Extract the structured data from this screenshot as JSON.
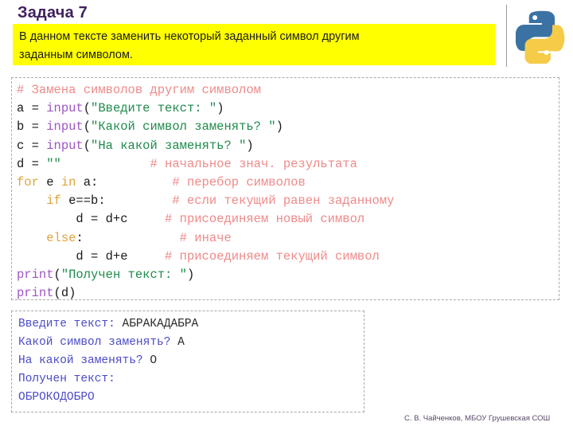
{
  "header": {
    "title": "Задача 7",
    "banner_lines": [
      "В данном тексте заменить некоторый заданный символ другим",
      "заданным символом."
    ],
    "banner_color": "#ffff00",
    "title_color": "#40205f",
    "logo_name": "python-logo",
    "logo_blue": "#3b72a4",
    "logo_yellow": "#f5cb48"
  },
  "code": {
    "language": "python",
    "colors": {
      "keyword": "#e0a43c",
      "function": "#9d57c4",
      "string": "#1f8b4c",
      "comment": "#ef8a8a",
      "plain": "#1a1a1a"
    },
    "lines": [
      {
        "segments": [
          {
            "t": "# Замена символов другим символом",
            "c": "cmt"
          }
        ]
      },
      {
        "segments": [
          {
            "t": "a = ",
            "c": "plain"
          },
          {
            "t": "input",
            "c": "fn"
          },
          {
            "t": "(",
            "c": "plain"
          },
          {
            "t": "\"Введите текст: \"",
            "c": "str"
          },
          {
            "t": ")",
            "c": "plain"
          }
        ]
      },
      {
        "segments": [
          {
            "t": "b = ",
            "c": "plain"
          },
          {
            "t": "input",
            "c": "fn"
          },
          {
            "t": "(",
            "c": "plain"
          },
          {
            "t": "\"Какой символ заменять? \"",
            "c": "str"
          },
          {
            "t": ")",
            "c": "plain"
          }
        ]
      },
      {
        "segments": [
          {
            "t": "c = ",
            "c": "plain"
          },
          {
            "t": "input",
            "c": "fn"
          },
          {
            "t": "(",
            "c": "plain"
          },
          {
            "t": "\"На какой заменять? \"",
            "c": "str"
          },
          {
            "t": ")",
            "c": "plain"
          }
        ]
      },
      {
        "segments": [
          {
            "t": "d = ",
            "c": "plain"
          },
          {
            "t": "\"\"",
            "c": "str"
          },
          {
            "t": "            ",
            "c": "plain"
          },
          {
            "t": "# начальное знач. результата",
            "c": "cmt"
          }
        ]
      },
      {
        "segments": [
          {
            "t": "for",
            "c": "kw"
          },
          {
            "t": " e ",
            "c": "plain"
          },
          {
            "t": "in",
            "c": "kw"
          },
          {
            "t": " a:",
            "c": "plain"
          },
          {
            "t": "          ",
            "c": "plain"
          },
          {
            "t": "# перебор символов",
            "c": "cmt"
          }
        ]
      },
      {
        "segments": [
          {
            "t": "    ",
            "c": "plain"
          },
          {
            "t": "if",
            "c": "kw"
          },
          {
            "t": " e==b:",
            "c": "plain"
          },
          {
            "t": "         ",
            "c": "plain"
          },
          {
            "t": "# если текущий равен заданному",
            "c": "cmt"
          }
        ]
      },
      {
        "segments": [
          {
            "t": "        d = d+c",
            "c": "plain"
          },
          {
            "t": "     ",
            "c": "plain"
          },
          {
            "t": "# присоединяем новый символ",
            "c": "cmt"
          }
        ]
      },
      {
        "segments": [
          {
            "t": "    ",
            "c": "plain"
          },
          {
            "t": "else",
            "c": "kw"
          },
          {
            "t": ":",
            "c": "plain"
          },
          {
            "t": "             ",
            "c": "plain"
          },
          {
            "t": "# иначе",
            "c": "cmt"
          }
        ]
      },
      {
        "segments": [
          {
            "t": "        d = d+e",
            "c": "plain"
          },
          {
            "t": "     ",
            "c": "plain"
          },
          {
            "t": "# присоединяем текущий символ",
            "c": "cmt"
          }
        ]
      },
      {
        "segments": [
          {
            "t": "print",
            "c": "fn"
          },
          {
            "t": "(",
            "c": "plain"
          },
          {
            "t": "\"Получен текст: \"",
            "c": "str"
          },
          {
            "t": ")",
            "c": "plain"
          }
        ]
      },
      {
        "segments": [
          {
            "t": "print",
            "c": "fn"
          },
          {
            "t": "(d)",
            "c": "plain"
          }
        ]
      }
    ]
  },
  "output": {
    "text_color": "#4b4bc8",
    "typed_color": "#2b2b2b",
    "lines": [
      {
        "segments": [
          {
            "t": "Введите текст: ",
            "c": "out"
          },
          {
            "t": "АБРАКАДАБРА",
            "c": "typed"
          }
        ]
      },
      {
        "segments": [
          {
            "t": "Какой символ заменять? ",
            "c": "out"
          },
          {
            "t": "А",
            "c": "typed"
          }
        ]
      },
      {
        "segments": [
          {
            "t": "На какой заменять? ",
            "c": "out"
          },
          {
            "t": "О",
            "c": "typed"
          }
        ]
      },
      {
        "segments": [
          {
            "t": "Получен текст:",
            "c": "out"
          }
        ]
      },
      {
        "segments": [
          {
            "t": "ОБРОКОДОБРО",
            "c": "out"
          }
        ]
      }
    ]
  },
  "footer": {
    "credit": "С. В. Чайченков, МБОУ Грушевская СОШ"
  }
}
